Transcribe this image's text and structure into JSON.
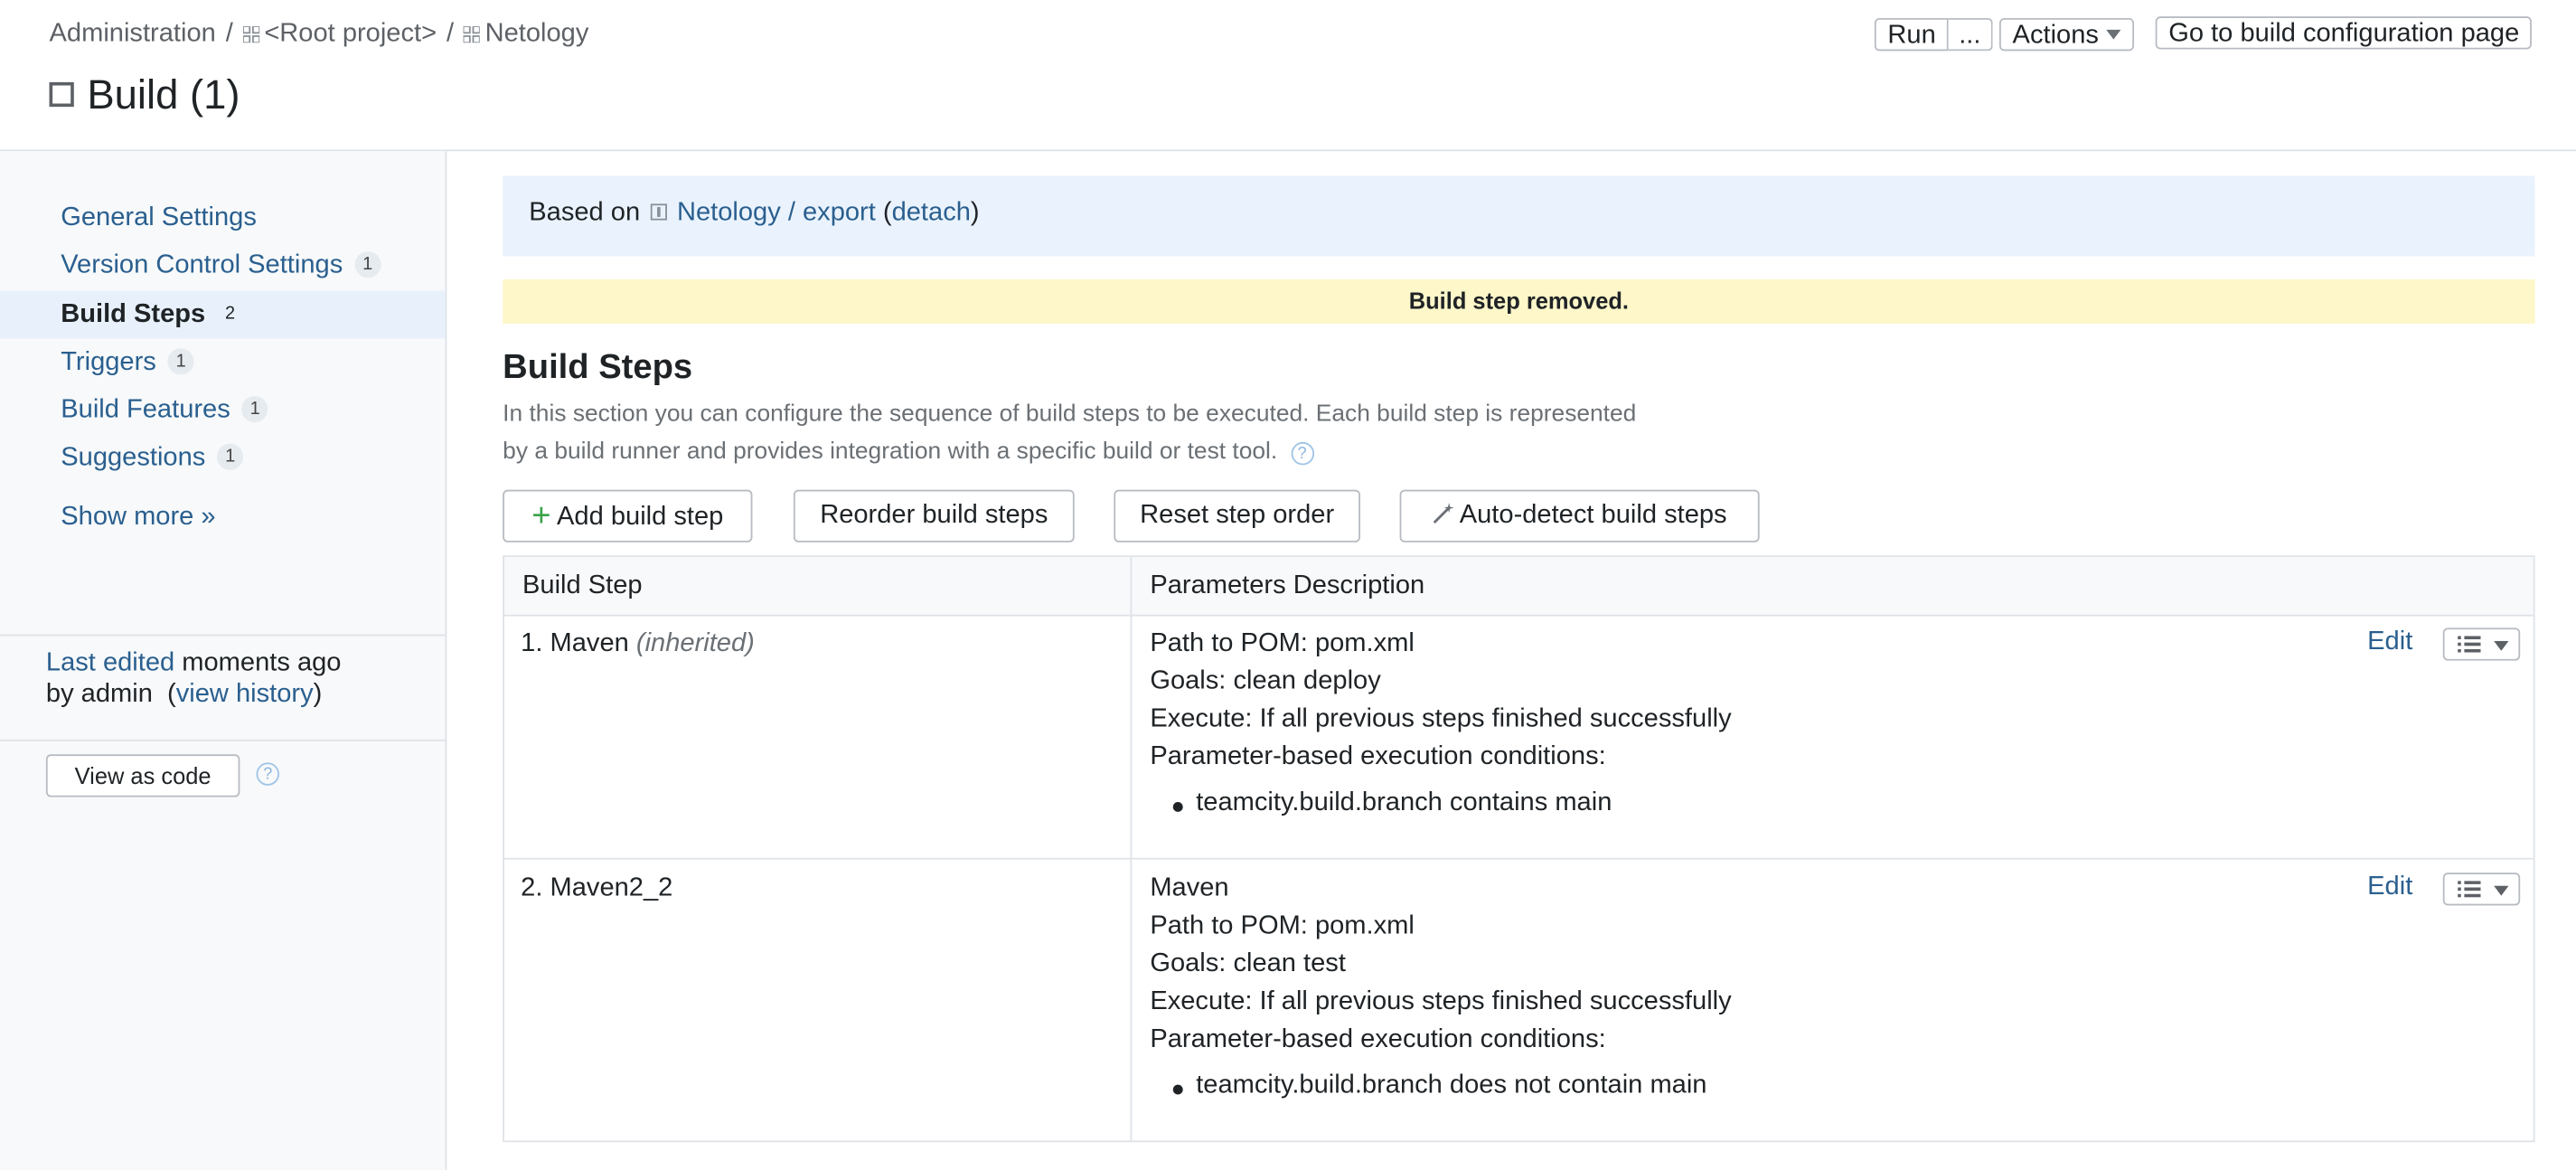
{
  "breadcrumb": {
    "admin": "Administration",
    "sep": "/",
    "root": "<Root project>",
    "project": "Netology"
  },
  "page_title": "Build (1)",
  "toolbar": {
    "run": "Run",
    "run_more": "...",
    "actions": "Actions",
    "goto": "Go to build configuration page"
  },
  "sidebar": {
    "items": [
      {
        "label": "General Settings",
        "badge": ""
      },
      {
        "label": "Version Control Settings",
        "badge": "1"
      },
      {
        "label": "Build Steps",
        "badge": "2",
        "active": true
      },
      {
        "label": "Triggers",
        "badge": "1"
      },
      {
        "label": "Build Features",
        "badge": "1"
      },
      {
        "label": "Suggestions",
        "badge": "1"
      }
    ],
    "show_more": "Show more »",
    "last_edited_link": "Last edited",
    "last_edited_when": "moments ago",
    "by_admin": "by admin",
    "view_history": "view history",
    "view_as_code": "View as code",
    "help": "?"
  },
  "based_on": {
    "prefix": "Based on",
    "template": "Netology / export",
    "detach": "detach"
  },
  "message": "Build step removed.",
  "section": {
    "title": "Build Steps",
    "desc_line1": "In this section you can configure the sequence of build steps to be executed. Each build step is represented",
    "desc_line2": "by a build runner and provides integration with a specific build or test tool."
  },
  "buttons": {
    "add": "Add build step",
    "reorder": "Reorder build steps",
    "reset": "Reset step order",
    "autodetect": "Auto-detect build steps"
  },
  "table": {
    "headers": [
      "Build Step",
      "Parameters Description"
    ],
    "rows": [
      {
        "name": "1. Maven",
        "note": "(inherited)",
        "lines": [
          "Path to POM: pom.xml",
          "Goals: clean deploy",
          "Execute: If all previous steps finished successfully",
          "Parameter-based execution conditions:"
        ],
        "condition": "teamcity.build.branch contains main",
        "edit": "Edit"
      },
      {
        "name": "2. Maven2_2",
        "note": "",
        "lines": [
          "Maven",
          "Path to POM: pom.xml",
          "Goals: clean test",
          "Execute: If all previous steps finished successfully",
          "Parameter-based execution conditions:"
        ],
        "condition": "teamcity.build.branch does not contain main",
        "edit": "Edit"
      }
    ]
  },
  "colors": {
    "link": "#2a5f8f",
    "notice_bg": "#fdf7c9",
    "info_bg": "#eaf3fd",
    "sidebar_bg": "#f7f9fa",
    "add_icon": "#3aa34a"
  }
}
